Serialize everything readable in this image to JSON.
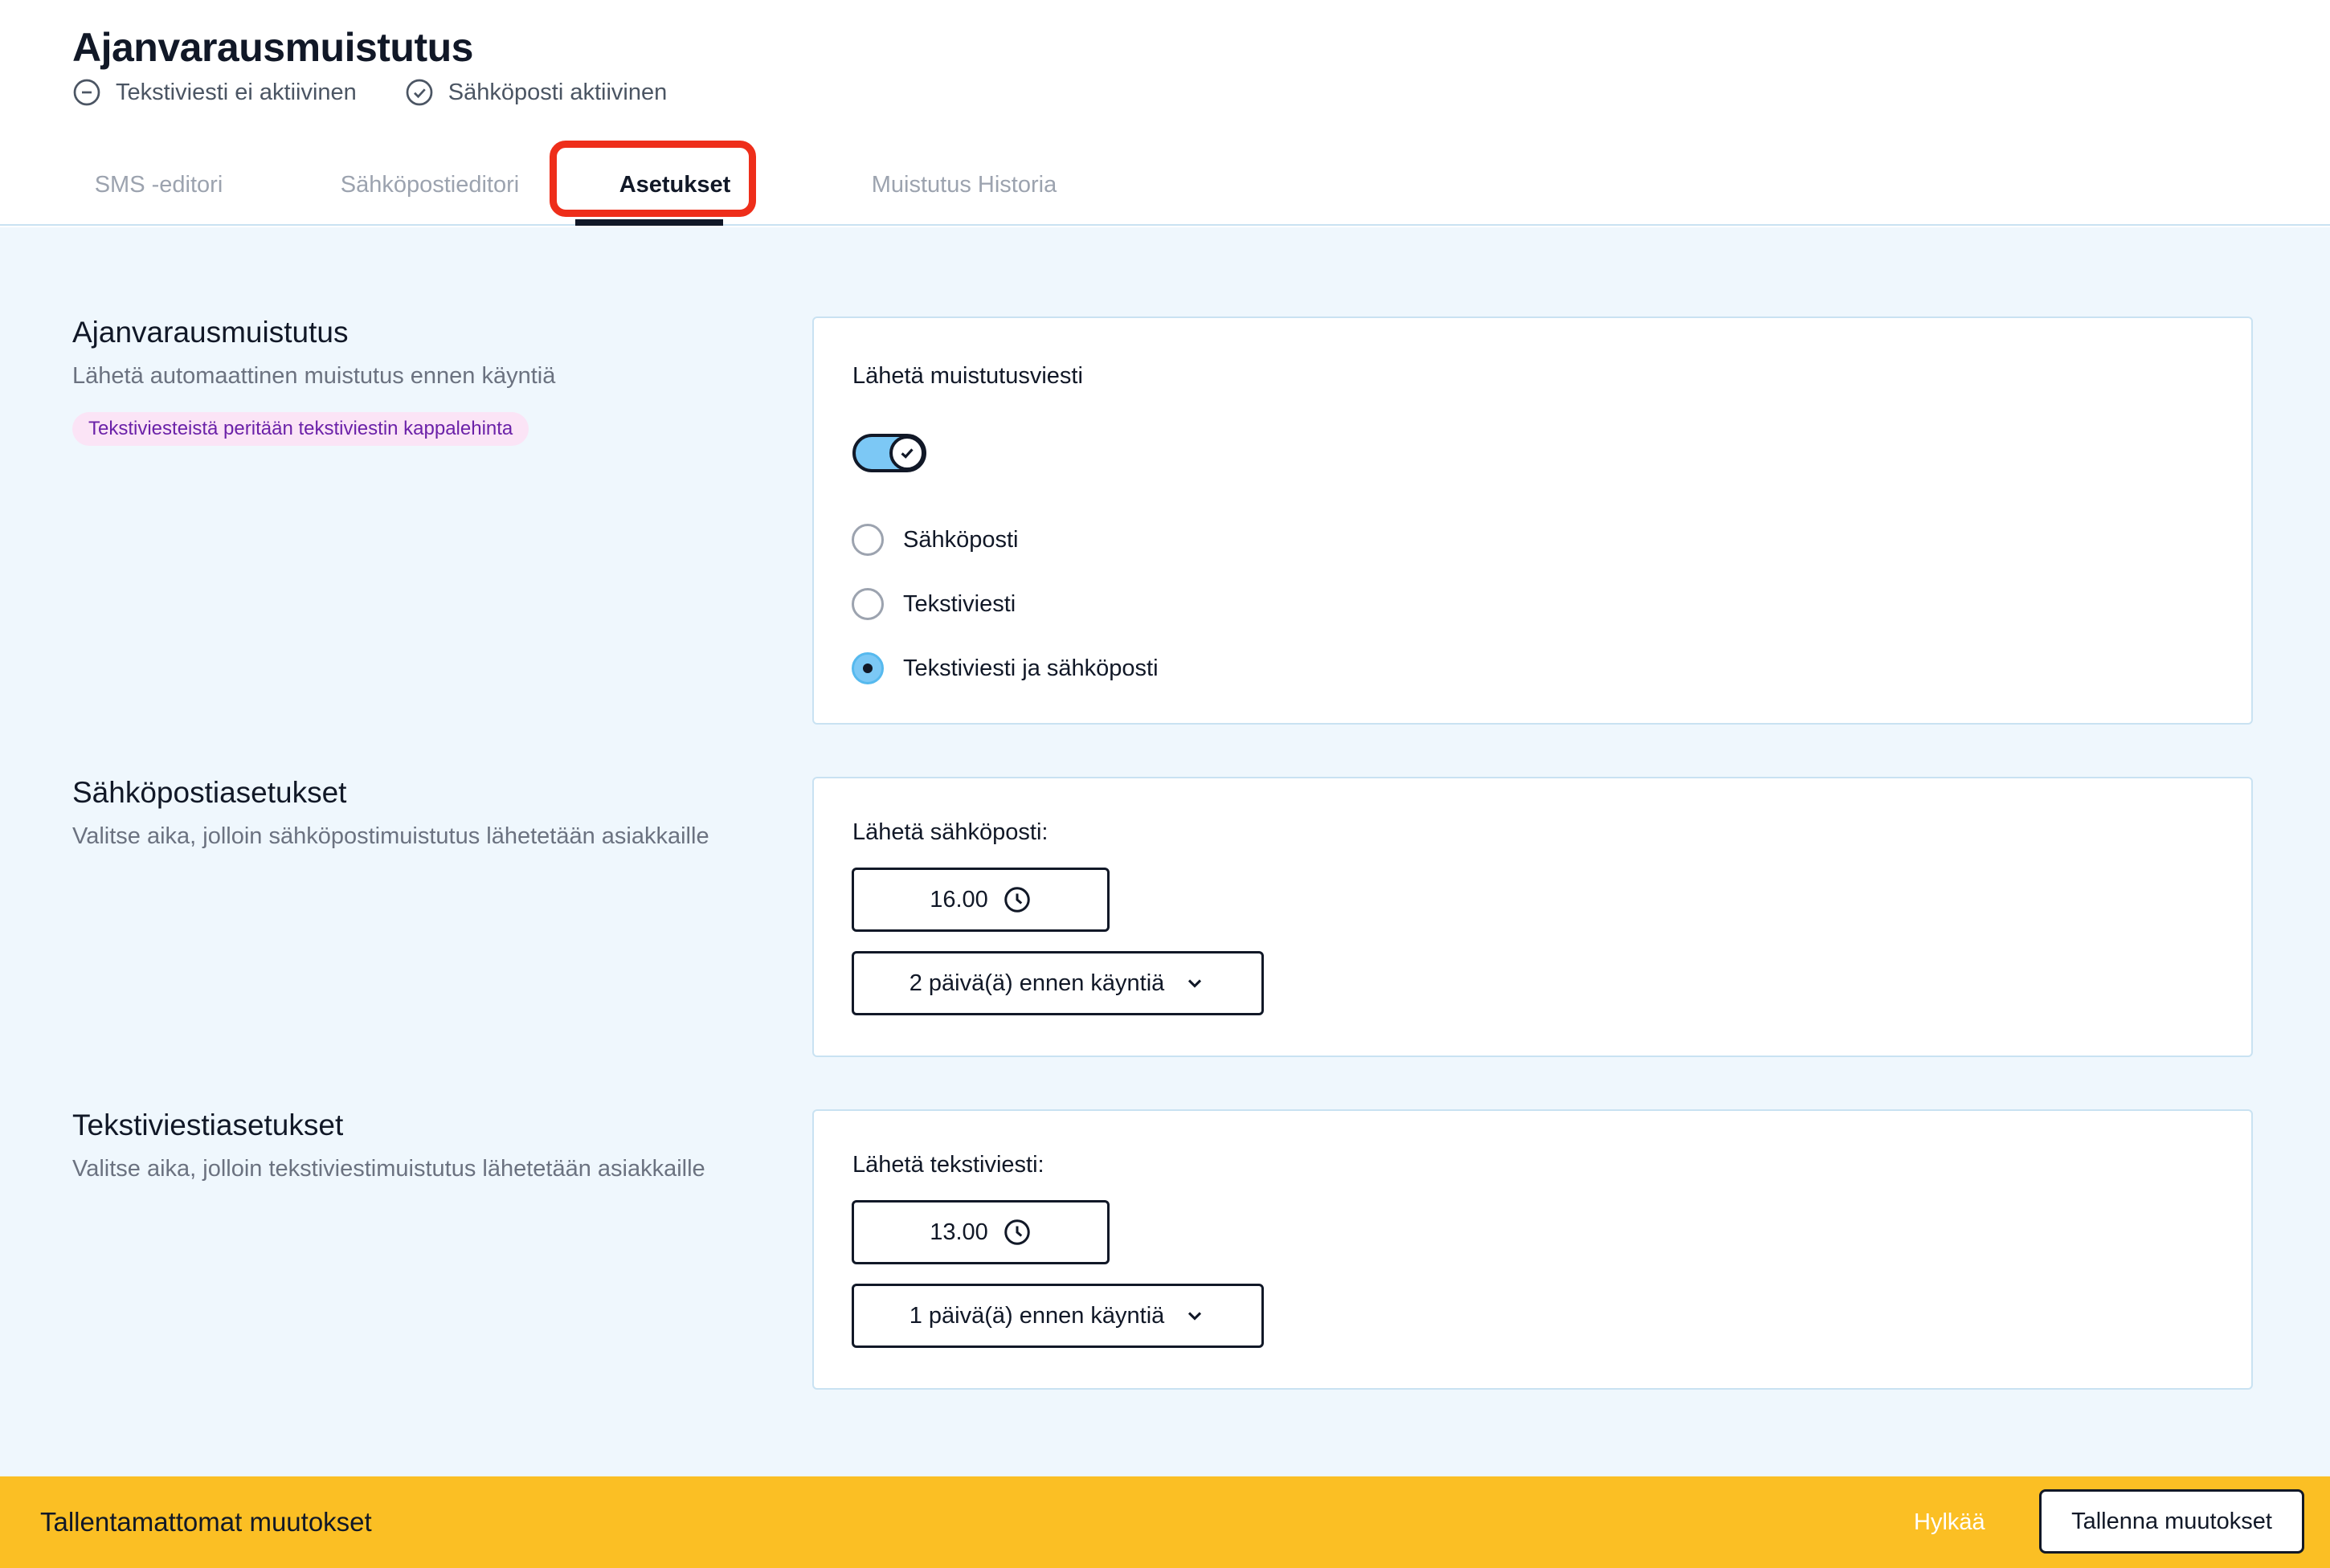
{
  "header": {
    "title": "Ajanvarausmuistutus",
    "status": [
      {
        "icon": "minus-circle-icon",
        "label": "Tekstiviesti ei aktiivinen"
      },
      {
        "icon": "check-circle-icon",
        "label": "Sähköposti aktiivinen"
      }
    ]
  },
  "tabs": [
    {
      "label": "SMS -editori",
      "active": false
    },
    {
      "label": "Sähköpostieditori",
      "active": false
    },
    {
      "label": "Asetukset",
      "active": true
    },
    {
      "label": "Muistutus Historia",
      "active": false
    }
  ],
  "sections": {
    "reminder": {
      "title": "Ajanvarausmuistutus",
      "description": "Lähetä automaattinen muistutus ennen käyntiä",
      "pill": "Tekstiviesteistä peritään tekstiviestin kappalehinta",
      "card": {
        "label": "Lähetä muistutusviesti",
        "toggle_on": true,
        "options": [
          {
            "label": "Sähköposti",
            "selected": false
          },
          {
            "label": "Tekstiviesti",
            "selected": false
          },
          {
            "label": "Tekstiviesti ja sähköposti",
            "selected": true
          }
        ]
      }
    },
    "email": {
      "title": "Sähköpostiasetukset",
      "description": "Valitse aika, jolloin sähköpostimuistutus lähetetään asiakkaille",
      "card": {
        "label": "Lähetä sähköposti:",
        "time": "16.00",
        "days_before": "2 päivä(ä) ennen käyntiä"
      }
    },
    "sms": {
      "title": "Tekstiviestiasetukset",
      "description": "Valitse aika, jolloin tekstiviestimuistutus lähetetään asiakkaille",
      "card": {
        "label": "Lähetä tekstiviesti:",
        "time": "13.00",
        "days_before": "1 päivä(ä) ennen käyntiä"
      }
    }
  },
  "footer": {
    "message": "Tallentamattomat muutokset",
    "discard_label": "Hylkää",
    "save_label": "Tallenna muutokset"
  },
  "colors": {
    "accent_blue": "#7cc8f5",
    "background": "#eff7fd",
    "footer_yellow": "#fbbf24",
    "highlight_red": "#ee2e1a",
    "pill_bg": "#fbe4f6",
    "pill_text": "#6b21a8"
  }
}
